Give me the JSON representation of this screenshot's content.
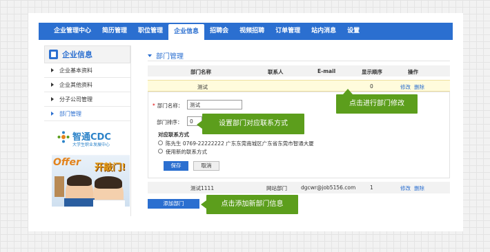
{
  "nav": {
    "items": [
      "企业管理中心",
      "简历管理",
      "职位管理",
      "企业信息",
      "招聘会",
      "视频招聘",
      "订单管理",
      "站内消息",
      "设置"
    ],
    "active_index": 3
  },
  "sidebar": {
    "title": "企业信息",
    "items": [
      "企业基本资料",
      "企业其他资料",
      "分子公司管理",
      "部门管理"
    ],
    "active_index": 3
  },
  "promo": {
    "brand": "智通CDC",
    "tagline": "大学生职业发展中心",
    "offer": "Offer",
    "slogan": "开敲门!"
  },
  "main": {
    "title": "部门管理",
    "table": {
      "headers": [
        "部门名称",
        "联系人",
        "E-mail",
        "显示顺序",
        "操作"
      ],
      "rows": [
        {
          "name": "测试",
          "contact": "",
          "email": "",
          "order": "0",
          "edit": "修改",
          "delete": "删除"
        },
        {
          "name": "测试1111",
          "contact": "网站部门",
          "email": "dgcwr@job5156.com",
          "order": "1",
          "edit": "修改",
          "delete": "删除"
        }
      ]
    },
    "form": {
      "name_label": "部门名称：",
      "name_value": "测试",
      "order_label": "部门排序：",
      "order_value": "0",
      "contact_label": "对应联系方式",
      "contact_option": "陈先生  0769-22222222  广东东莞南城区广东省东莞市智通大厦",
      "new_contact_option": "使用新的联系方式",
      "save": "保存",
      "cancel": "取消"
    },
    "add_button": "添加部门"
  },
  "callouts": {
    "edit": "点击进行部门修改",
    "contact": "设置部门对应联系方式",
    "add": "点击添加新部门信息"
  },
  "colors": {
    "primary": "#2b6fd0",
    "callout": "#5c9e1c",
    "highlight_row": "#fffbdc"
  }
}
